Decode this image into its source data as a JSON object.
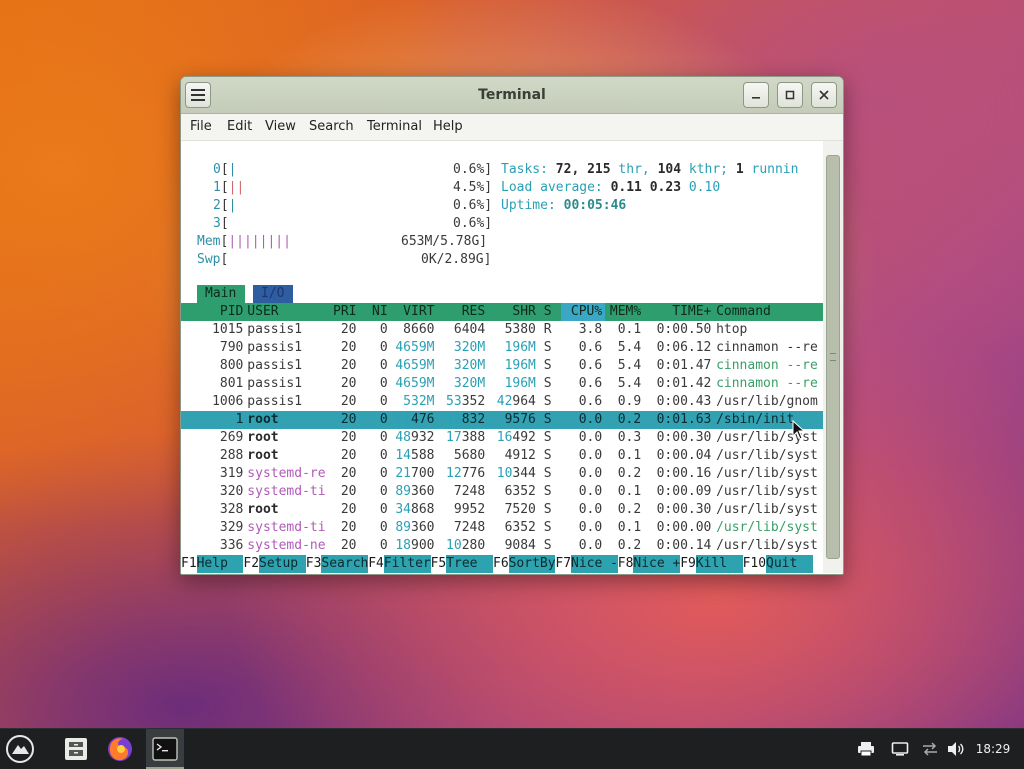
{
  "window": {
    "title": "Terminal",
    "menu": [
      "File",
      "Edit",
      "View",
      "Search",
      "Terminal",
      "Help"
    ]
  },
  "htop": {
    "cpus": [
      {
        "id": "0",
        "bars": "|",
        "pct": "0.6%]"
      },
      {
        "id": "1",
        "bars": "||",
        "pct": "4.5%]"
      },
      {
        "id": "2",
        "bars": "|",
        "pct": "0.6%]"
      },
      {
        "id": "3",
        "bars": "",
        "pct": "0.6%]"
      }
    ],
    "mem": {
      "label": "Mem",
      "bars": "||||||||",
      "value": "653M/5.78G]"
    },
    "swp": {
      "label": "Swp",
      "bars": "",
      "value": "0K/2.89G]"
    },
    "tasks": {
      "label": "Tasks:",
      "count": "72,",
      "thr": "215",
      "thr_lbl": "thr,",
      "kthr": "104",
      "kthr_lbl": "kthr;",
      "running": "1",
      "running_lbl": "runnin"
    },
    "load": {
      "label": "Load average:",
      "v1": "0.11",
      "v5": "0.23",
      "v15": "0.10"
    },
    "uptime": {
      "label": "Uptime:",
      "value": "00:05:46"
    },
    "tabs": [
      "Main",
      "I/O"
    ],
    "columns": {
      "pid": "PID",
      "user": "USER",
      "pri": "PRI",
      "ni": "NI",
      "virt": "VIRT",
      "res": "RES",
      "shr": "SHR",
      "s": "S",
      "cpu": "CPU%",
      "mem": "MEM%",
      "time": "TIME+",
      "command": "Command"
    },
    "processes": [
      {
        "pid": "1015",
        "user": "passis1",
        "pri": "20",
        "ni": "0",
        "virt": "8660",
        "res": "6404",
        "shr": "5380",
        "s": "R",
        "cpu": "3.8",
        "mem": "0.1",
        "time": "0:00.50",
        "command": "htop"
      },
      {
        "pid": "790",
        "user": "passis1",
        "pri": "20",
        "ni": "0",
        "virt": "4659M",
        "res": "320M",
        "shr": "196M",
        "s": "S",
        "cpu": "0.6",
        "mem": "5.4",
        "time": "0:06.12",
        "command": "cinnamon --re"
      },
      {
        "pid": "800",
        "user": "passis1",
        "pri": "20",
        "ni": "0",
        "virt": "4659M",
        "res": "320M",
        "shr": "196M",
        "s": "S",
        "cpu": "0.6",
        "mem": "5.4",
        "time": "0:01.47",
        "command": "cinnamon --re"
      },
      {
        "pid": "801",
        "user": "passis1",
        "pri": "20",
        "ni": "0",
        "virt": "4659M",
        "res": "320M",
        "shr": "196M",
        "s": "S",
        "cpu": "0.6",
        "mem": "5.4",
        "time": "0:01.42",
        "command": "cinnamon --re"
      },
      {
        "pid": "1006",
        "user": "passis1",
        "pri": "20",
        "ni": "0",
        "virt": "532M",
        "res": "53352",
        "shr": "42964",
        "s": "S",
        "cpu": "0.6",
        "mem": "0.9",
        "time": "0:00.43",
        "command": "/usr/lib/gnom"
      },
      {
        "pid": "1",
        "user": "root",
        "pri": "20",
        "ni": "0",
        "virt": "21476",
        "res": "12832",
        "shr": "9576",
        "s": "S",
        "cpu": "0.0",
        "mem": "0.2",
        "time": "0:01.63",
        "command": "/sbin/init"
      },
      {
        "pid": "269",
        "user": "root",
        "pri": "20",
        "ni": "0",
        "virt": "48932",
        "res": "17388",
        "shr": "16492",
        "s": "S",
        "cpu": "0.0",
        "mem": "0.3",
        "time": "0:00.30",
        "command": "/usr/lib/syst"
      },
      {
        "pid": "288",
        "user": "root",
        "pri": "20",
        "ni": "0",
        "virt": "14588",
        "res": "5680",
        "shr": "4912",
        "s": "S",
        "cpu": "0.0",
        "mem": "0.1",
        "time": "0:00.04",
        "command": "/usr/lib/syst"
      },
      {
        "pid": "319",
        "user": "systemd-re",
        "pri": "20",
        "ni": "0",
        "virt": "21700",
        "res": "12776",
        "shr": "10344",
        "s": "S",
        "cpu": "0.0",
        "mem": "0.2",
        "time": "0:00.16",
        "command": "/usr/lib/syst"
      },
      {
        "pid": "320",
        "user": "systemd-ti",
        "pri": "20",
        "ni": "0",
        "virt": "89360",
        "res": "7248",
        "shr": "6352",
        "s": "S",
        "cpu": "0.0",
        "mem": "0.1",
        "time": "0:00.09",
        "command": "/usr/lib/syst"
      },
      {
        "pid": "328",
        "user": "root",
        "pri": "20",
        "ni": "0",
        "virt": "34868",
        "res": "9952",
        "shr": "7520",
        "s": "S",
        "cpu": "0.0",
        "mem": "0.2",
        "time": "0:00.30",
        "command": "/usr/lib/syst"
      },
      {
        "pid": "329",
        "user": "systemd-ti",
        "pri": "20",
        "ni": "0",
        "virt": "89360",
        "res": "7248",
        "shr": "6352",
        "s": "S",
        "cpu": "0.0",
        "mem": "0.1",
        "time": "0:00.00",
        "command": "/usr/lib/syst"
      },
      {
        "pid": "336",
        "user": "systemd-ne",
        "pri": "20",
        "ni": "0",
        "virt": "18900",
        "res": "10280",
        "shr": "9084",
        "s": "S",
        "cpu": "0.0",
        "mem": "0.2",
        "time": "0:00.14",
        "command": "/usr/lib/syst"
      }
    ],
    "fkeys": [
      {
        "key": "F1",
        "label": "Help"
      },
      {
        "key": "F2",
        "label": "Setup"
      },
      {
        "key": "F3",
        "label": "Search"
      },
      {
        "key": "F4",
        "label": "Filter"
      },
      {
        "key": "F5",
        "label": "Tree"
      },
      {
        "key": "F6",
        "label": "SortBy"
      },
      {
        "key": "F7",
        "label": "Nice -"
      },
      {
        "key": "F8",
        "label": "Nice +"
      },
      {
        "key": "F9",
        "label": "Kill"
      },
      {
        "key": "F10",
        "label": "Quit"
      }
    ]
  },
  "taskbar": {
    "clock": "18:29",
    "apps": [
      "menu-icon",
      "file-manager-icon",
      "firefox-icon",
      "terminal-icon"
    ],
    "tray": [
      "printer-icon",
      "display-icon",
      "network-icon",
      "volume-icon"
    ]
  },
  "colors": {
    "header_bar": "#2e9e6f",
    "selected_row": "#32a2b3",
    "fkey_label": "#2ea3b0",
    "titlebar": "#c4ccb9",
    "taskbar": "#1d1f21"
  }
}
